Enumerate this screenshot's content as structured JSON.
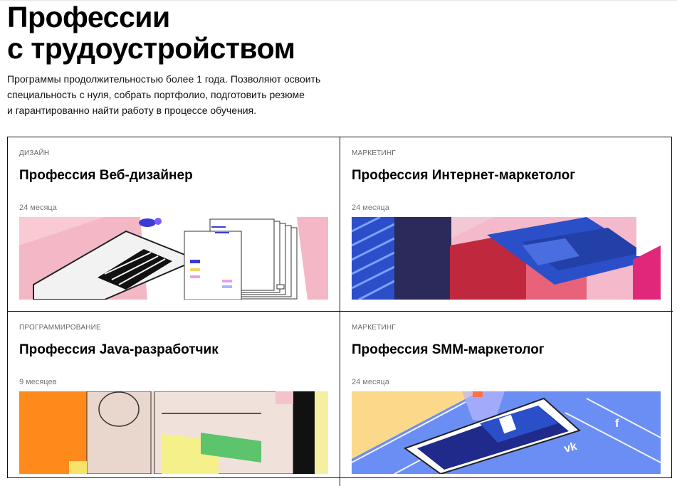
{
  "header": {
    "title_line1": "Профессии",
    "title_line2": "с трудоустройством",
    "description_lines": [
      "Программы продолжительностью более 1 года. Позволяют освоить",
      "специальность с нуля, собрать портфолио, подготовить резюме",
      "и гарантированно найти работу в процессе обучения."
    ]
  },
  "cards": [
    {
      "category": "ДИЗАЙН",
      "title": "Профессия Веб-дизайнер",
      "duration": "24 месяца",
      "illustration": "laptop-web-design-illustration"
    },
    {
      "category": "МАРКЕТИНГ",
      "title": "Профессия Интернет-маркетолог",
      "duration": "24 месяца",
      "illustration": "laptop-marketing-illustration"
    },
    {
      "category": "ПРОГРАММИРОВАНИЕ",
      "title": "Профессия Java-разработчик",
      "duration": "9 месяцев",
      "illustration": "code-window-illustration"
    },
    {
      "category": "МАРКЕТИНГ",
      "title": "Профессия SMM-маркетолог",
      "duration": "24 месяца",
      "illustration": "smartphone-social-illustration"
    }
  ],
  "colors": {
    "border": "#111111",
    "pink": "#f8c8d3",
    "navy": "#2c2a5a",
    "blue": "#2b4fc9",
    "orange": "#ff8a1c",
    "yellow": "#fcd98a"
  }
}
